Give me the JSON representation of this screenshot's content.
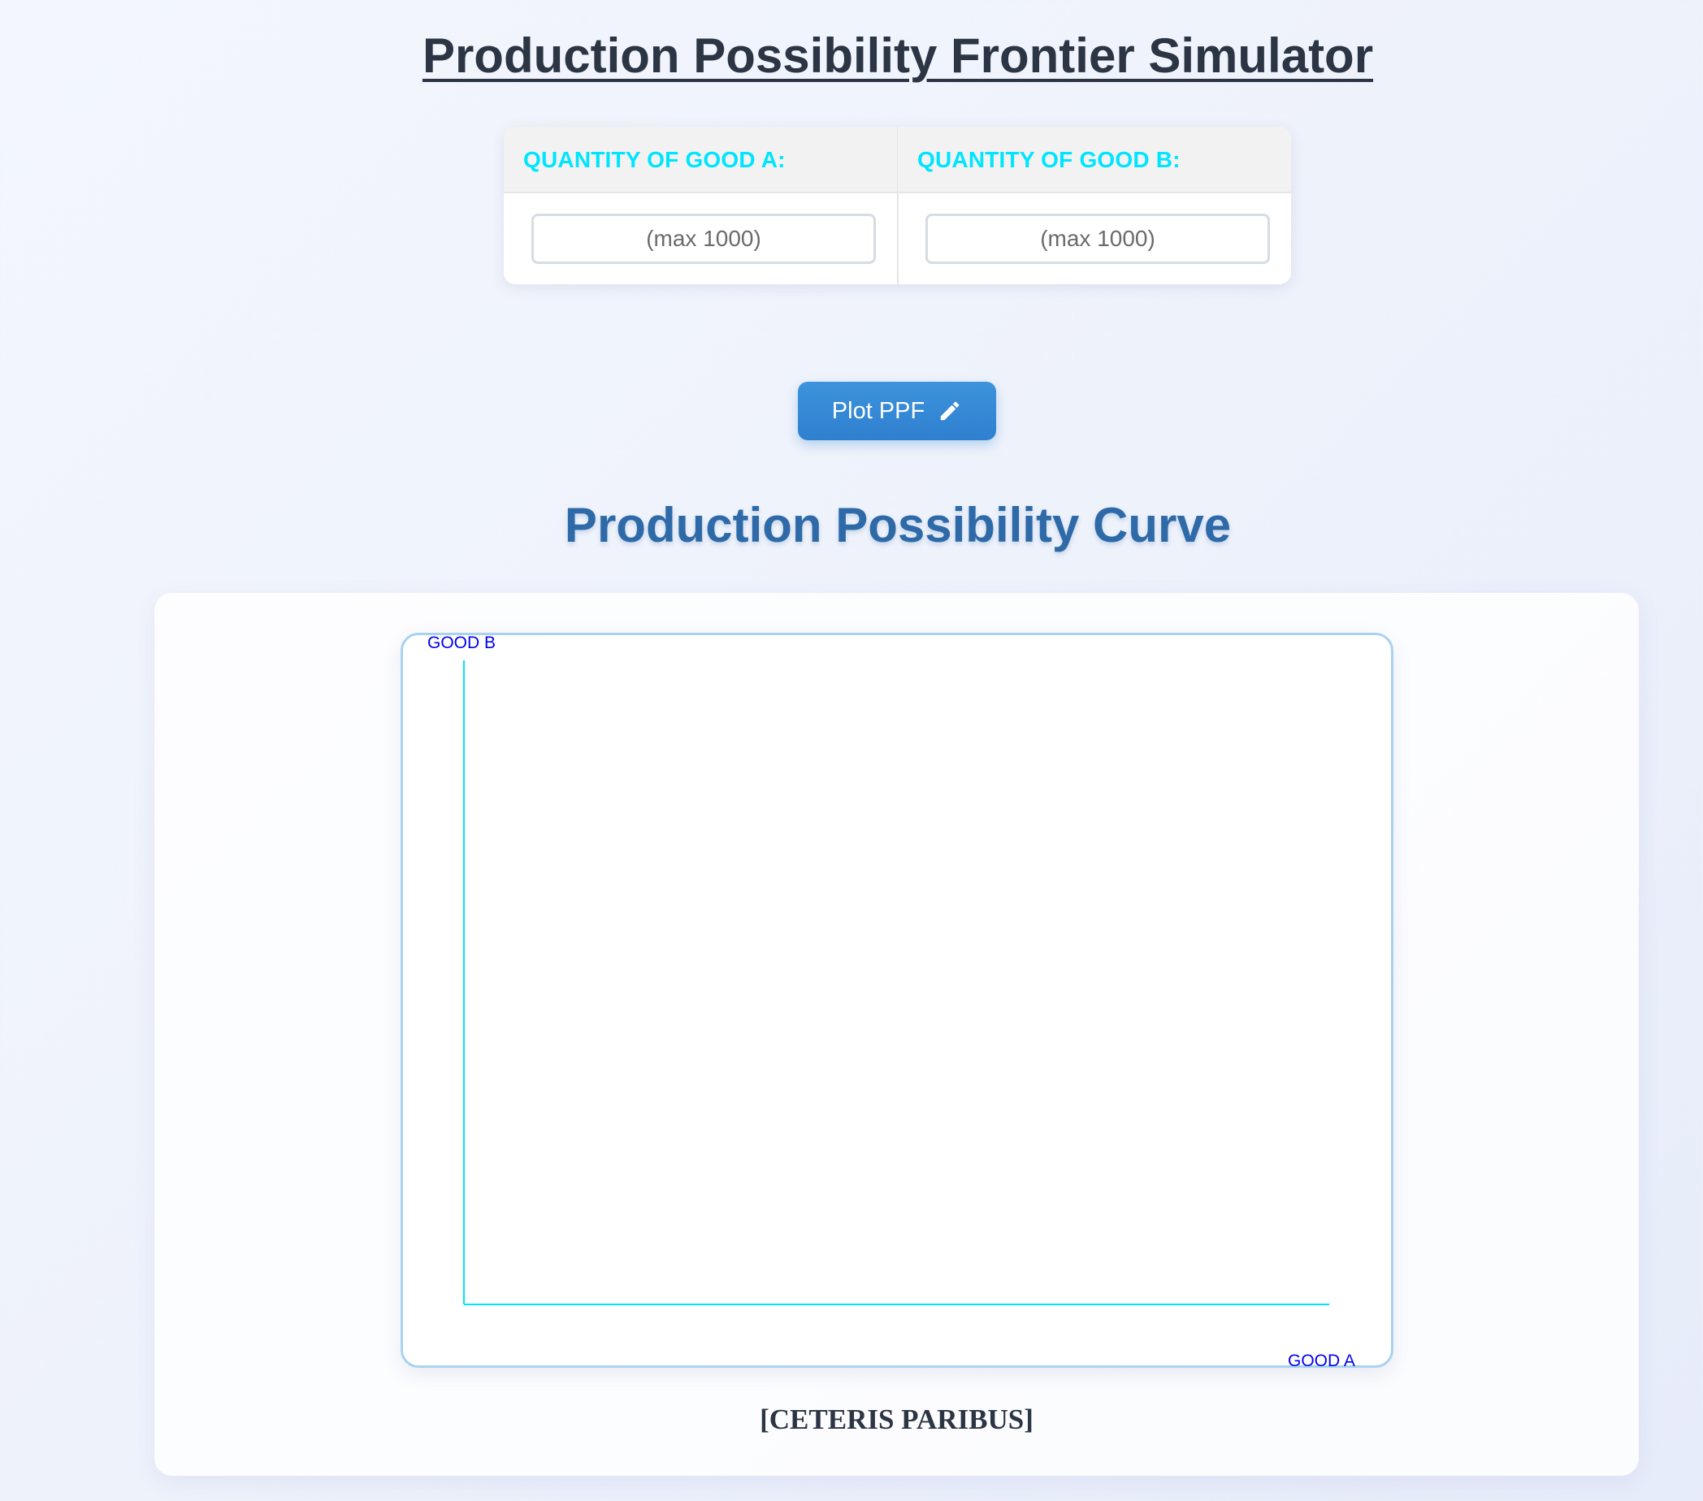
{
  "header": {
    "title": "Production Possibility Frontier Simulator"
  },
  "inputs": {
    "good_a": {
      "label": "QUANTITY OF GOOD A:",
      "placeholder": "(max 1000)",
      "value": ""
    },
    "good_b": {
      "label": "QUANTITY OF GOOD B:",
      "placeholder": "(max 1000)",
      "value": ""
    }
  },
  "actions": {
    "plot_label": "Plot PPF",
    "plot_icon": "pencil-icon"
  },
  "chart": {
    "section_title": "Production Possibility Curve",
    "footer_note": "[CETERIS PARIBUS]"
  },
  "chart_data": {
    "type": "line",
    "title": "",
    "xlabel": "GOOD A",
    "ylabel": "GOOD B",
    "series": [],
    "grid": false,
    "axis_color": "#00e5ff",
    "label_color": "#0000ee"
  },
  "colors": {
    "label_accent": "#00e5ff",
    "button": "#2f80cf",
    "section_title": "#2f6aa8",
    "frame_border": "#a9d2ee"
  }
}
